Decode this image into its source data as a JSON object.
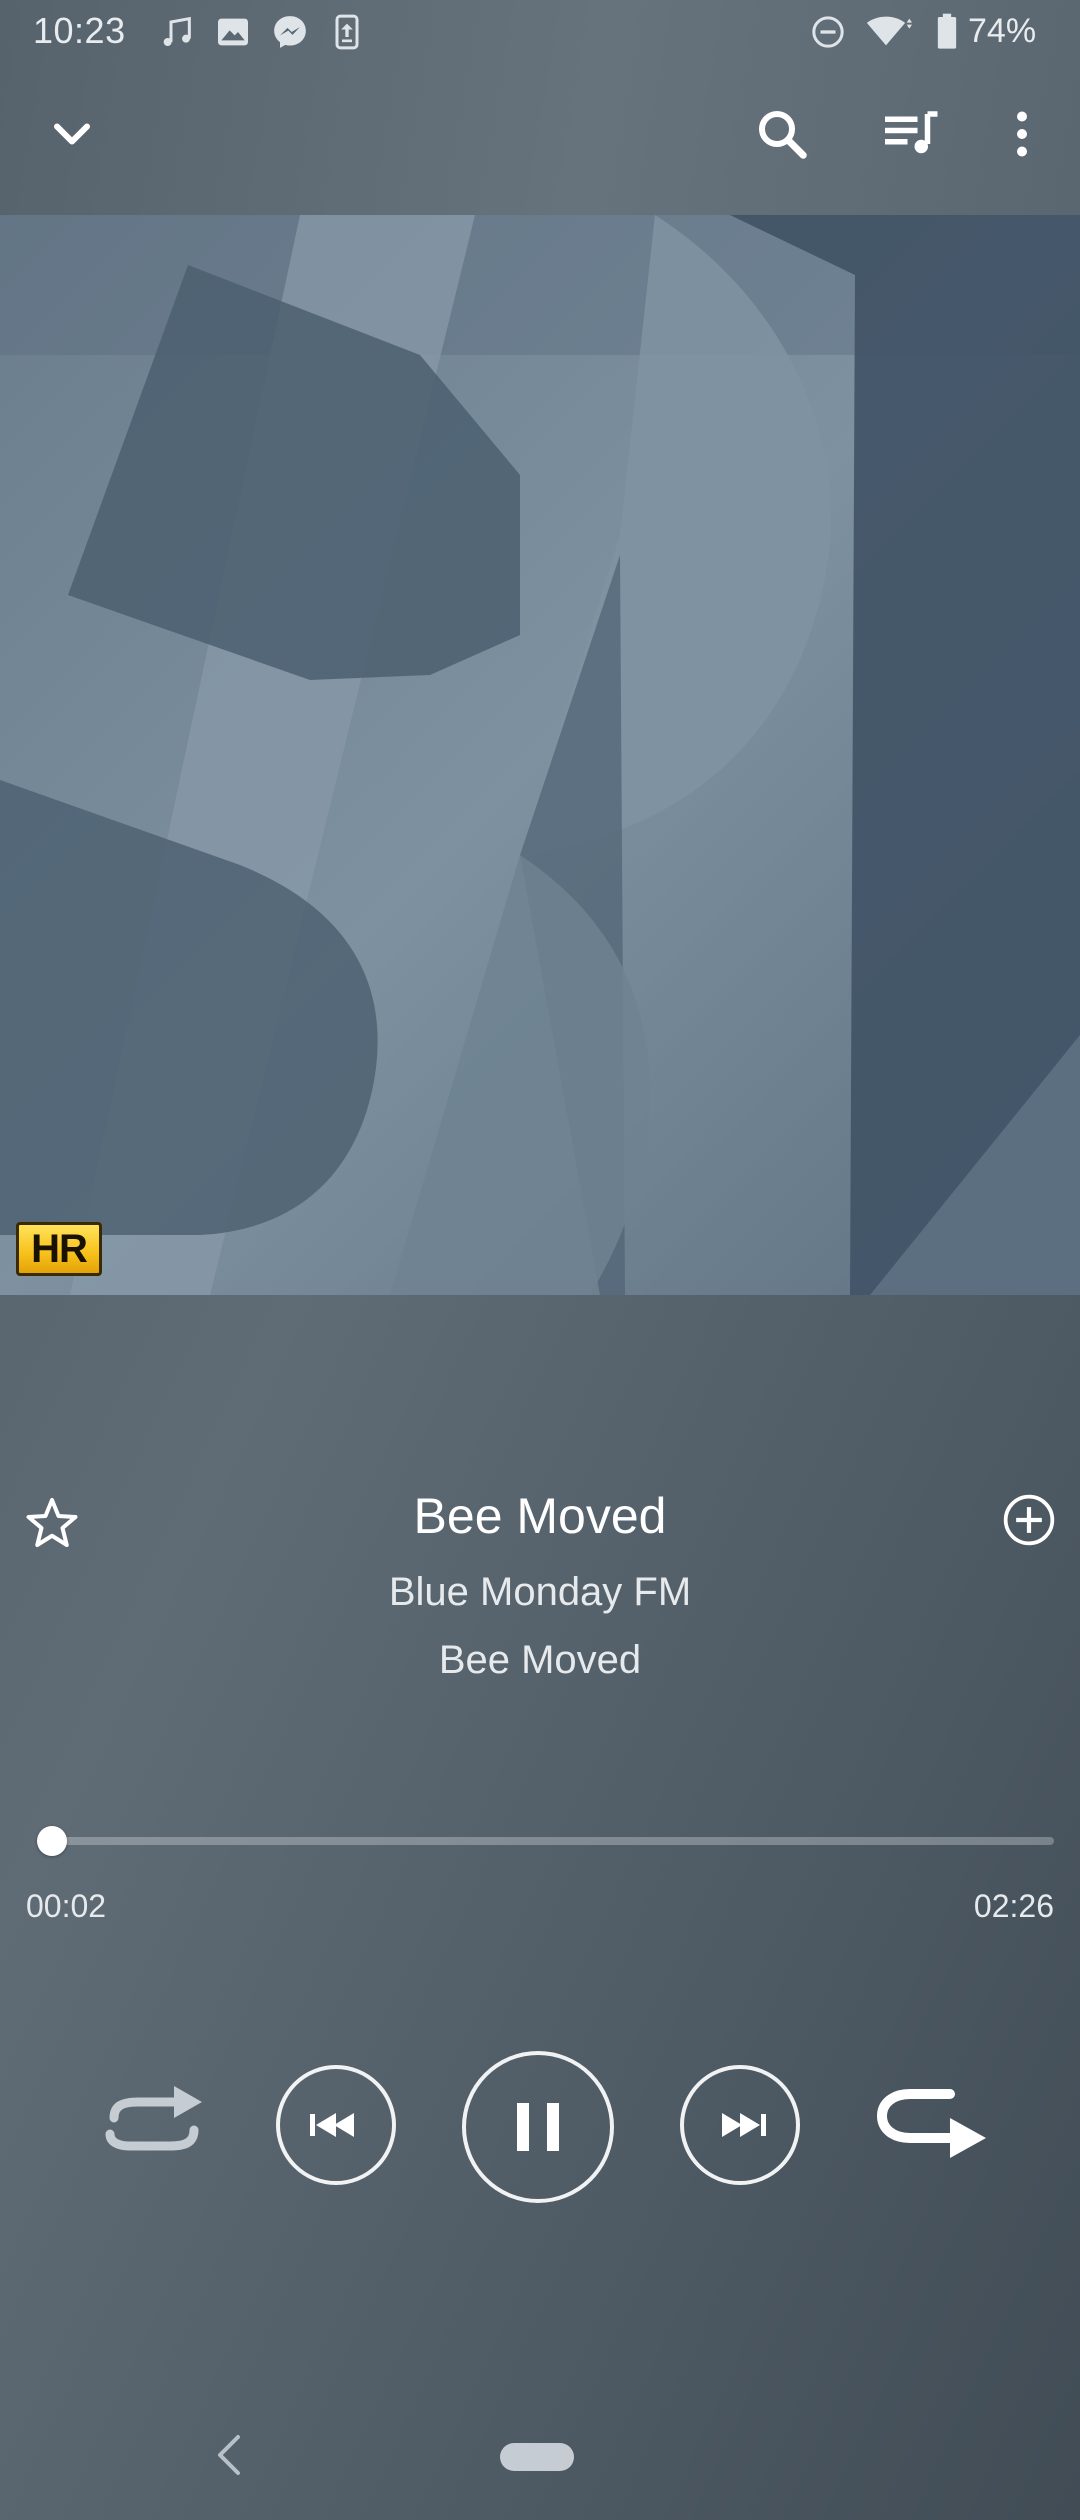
{
  "status_bar": {
    "time": "10:23",
    "battery_percent": "74%",
    "notification_icons": [
      "music-note-icon",
      "image-icon",
      "messenger-icon",
      "upload-icon"
    ],
    "system_icons": [
      "do-not-disturb-icon",
      "wifi-icon",
      "battery-icon"
    ]
  },
  "toolbar": {
    "icons": [
      "chevron-down-icon",
      "search-icon",
      "queue-music-icon",
      "more-vert-icon"
    ]
  },
  "album_art": {
    "badge": "HR"
  },
  "track": {
    "title": "Bee Moved",
    "artist": "Blue Monday FM",
    "album": "Bee Moved"
  },
  "playback": {
    "elapsed": "00:02",
    "duration": "02:26",
    "progress_fraction": 0.014,
    "state": "playing"
  },
  "controls": {
    "icons": [
      "repeat-icon",
      "previous-icon",
      "pause-icon",
      "next-icon",
      "shuffle-off-icon"
    ]
  },
  "colors": {
    "accent": "#ffffff",
    "hr_badge": "#f7c11a",
    "background": "#56626c"
  }
}
